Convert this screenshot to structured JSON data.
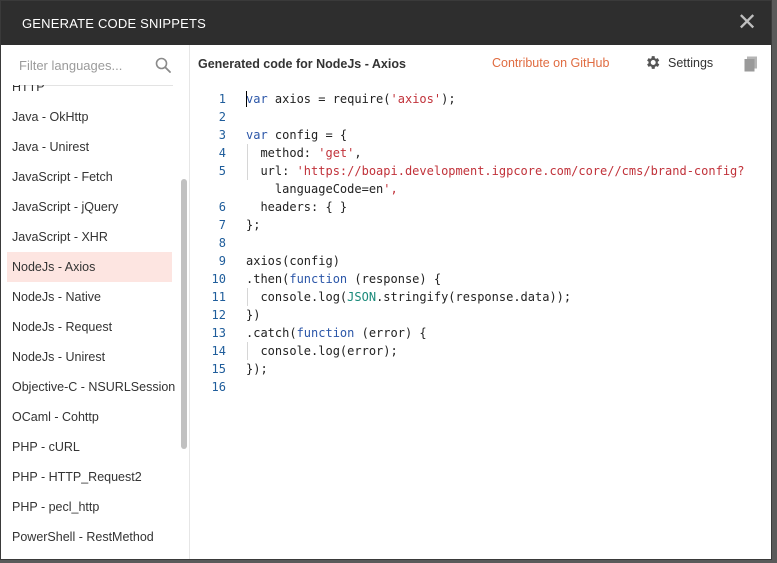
{
  "modal": {
    "title": "GENERATE CODE SNIPPETS",
    "close_glyph": "✕"
  },
  "sidebar": {
    "filter_placeholder": "Filter languages...",
    "items": [
      "HTTP",
      "Java - OkHttp",
      "Java - Unirest",
      "JavaScript - Fetch",
      "JavaScript - jQuery",
      "JavaScript - XHR",
      "NodeJs - Axios",
      "NodeJs - Native",
      "NodeJs - Request",
      "NodeJs - Unirest",
      "Objective-C - NSURLSession",
      "OCaml - Cohttp",
      "PHP - cURL",
      "PHP - HTTP_Request2",
      "PHP - pecl_http",
      "PowerShell - RestMethod"
    ],
    "selected_index": 6
  },
  "main": {
    "title": "Generated code for NodeJs - Axios",
    "github_link": "Contribute on GitHub",
    "settings_label": "Settings"
  },
  "code": {
    "line_numbers": [
      "1",
      "2",
      "3",
      "4",
      "5",
      "",
      "6",
      "7",
      "8",
      "9",
      "10",
      "11",
      "12",
      "13",
      "14",
      "15",
      "16"
    ],
    "lines": [
      "var axios = require('axios');",
      "",
      "var config = {",
      "  method: 'get',",
      "  url: 'https://boapi.development.igpcore.com/core//cms/brand-config?",
      "    languageCode=en',",
      "  headers: { }",
      "};",
      "",
      "axios(config)",
      ".then(function (response) {",
      "  console.log(JSON.stringify(response.data));",
      "})",
      ".catch(function (error) {",
      "  console.log(error);",
      "});",
      ""
    ]
  },
  "colors": {
    "accent": "#e06c41",
    "selected_bg": "#fde5e1",
    "header_bg": "#2e2e2e"
  }
}
